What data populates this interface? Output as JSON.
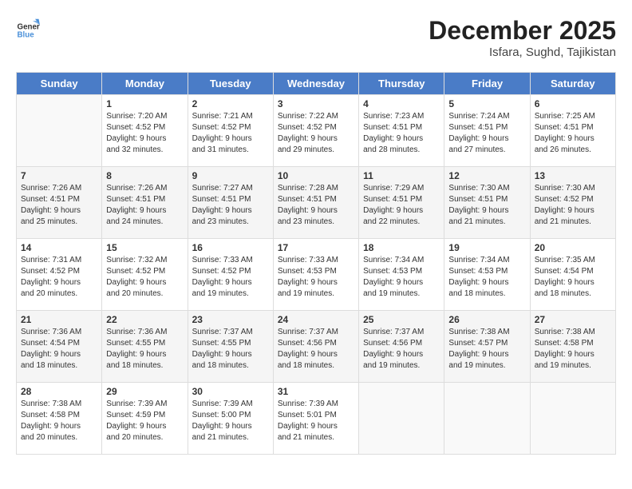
{
  "header": {
    "logo_general": "General",
    "logo_blue": "Blue",
    "month": "December 2025",
    "location": "Isfara, Sughd, Tajikistan"
  },
  "days_of_week": [
    "Sunday",
    "Monday",
    "Tuesday",
    "Wednesday",
    "Thursday",
    "Friday",
    "Saturday"
  ],
  "weeks": [
    [
      {
        "day": "",
        "info": ""
      },
      {
        "day": "1",
        "info": "Sunrise: 7:20 AM\nSunset: 4:52 PM\nDaylight: 9 hours\nand 32 minutes."
      },
      {
        "day": "2",
        "info": "Sunrise: 7:21 AM\nSunset: 4:52 PM\nDaylight: 9 hours\nand 31 minutes."
      },
      {
        "day": "3",
        "info": "Sunrise: 7:22 AM\nSunset: 4:52 PM\nDaylight: 9 hours\nand 29 minutes."
      },
      {
        "day": "4",
        "info": "Sunrise: 7:23 AM\nSunset: 4:51 PM\nDaylight: 9 hours\nand 28 minutes."
      },
      {
        "day": "5",
        "info": "Sunrise: 7:24 AM\nSunset: 4:51 PM\nDaylight: 9 hours\nand 27 minutes."
      },
      {
        "day": "6",
        "info": "Sunrise: 7:25 AM\nSunset: 4:51 PM\nDaylight: 9 hours\nand 26 minutes."
      }
    ],
    [
      {
        "day": "7",
        "info": "Sunrise: 7:26 AM\nSunset: 4:51 PM\nDaylight: 9 hours\nand 25 minutes."
      },
      {
        "day": "8",
        "info": "Sunrise: 7:26 AM\nSunset: 4:51 PM\nDaylight: 9 hours\nand 24 minutes."
      },
      {
        "day": "9",
        "info": "Sunrise: 7:27 AM\nSunset: 4:51 PM\nDaylight: 9 hours\nand 23 minutes."
      },
      {
        "day": "10",
        "info": "Sunrise: 7:28 AM\nSunset: 4:51 PM\nDaylight: 9 hours\nand 23 minutes."
      },
      {
        "day": "11",
        "info": "Sunrise: 7:29 AM\nSunset: 4:51 PM\nDaylight: 9 hours\nand 22 minutes."
      },
      {
        "day": "12",
        "info": "Sunrise: 7:30 AM\nSunset: 4:51 PM\nDaylight: 9 hours\nand 21 minutes."
      },
      {
        "day": "13",
        "info": "Sunrise: 7:30 AM\nSunset: 4:52 PM\nDaylight: 9 hours\nand 21 minutes."
      }
    ],
    [
      {
        "day": "14",
        "info": "Sunrise: 7:31 AM\nSunset: 4:52 PM\nDaylight: 9 hours\nand 20 minutes."
      },
      {
        "day": "15",
        "info": "Sunrise: 7:32 AM\nSunset: 4:52 PM\nDaylight: 9 hours\nand 20 minutes."
      },
      {
        "day": "16",
        "info": "Sunrise: 7:33 AM\nSunset: 4:52 PM\nDaylight: 9 hours\nand 19 minutes."
      },
      {
        "day": "17",
        "info": "Sunrise: 7:33 AM\nSunset: 4:53 PM\nDaylight: 9 hours\nand 19 minutes."
      },
      {
        "day": "18",
        "info": "Sunrise: 7:34 AM\nSunset: 4:53 PM\nDaylight: 9 hours\nand 19 minutes."
      },
      {
        "day": "19",
        "info": "Sunrise: 7:34 AM\nSunset: 4:53 PM\nDaylight: 9 hours\nand 18 minutes."
      },
      {
        "day": "20",
        "info": "Sunrise: 7:35 AM\nSunset: 4:54 PM\nDaylight: 9 hours\nand 18 minutes."
      }
    ],
    [
      {
        "day": "21",
        "info": "Sunrise: 7:36 AM\nSunset: 4:54 PM\nDaylight: 9 hours\nand 18 minutes."
      },
      {
        "day": "22",
        "info": "Sunrise: 7:36 AM\nSunset: 4:55 PM\nDaylight: 9 hours\nand 18 minutes."
      },
      {
        "day": "23",
        "info": "Sunrise: 7:37 AM\nSunset: 4:55 PM\nDaylight: 9 hours\nand 18 minutes."
      },
      {
        "day": "24",
        "info": "Sunrise: 7:37 AM\nSunset: 4:56 PM\nDaylight: 9 hours\nand 18 minutes."
      },
      {
        "day": "25",
        "info": "Sunrise: 7:37 AM\nSunset: 4:56 PM\nDaylight: 9 hours\nand 19 minutes."
      },
      {
        "day": "26",
        "info": "Sunrise: 7:38 AM\nSunset: 4:57 PM\nDaylight: 9 hours\nand 19 minutes."
      },
      {
        "day": "27",
        "info": "Sunrise: 7:38 AM\nSunset: 4:58 PM\nDaylight: 9 hours\nand 19 minutes."
      }
    ],
    [
      {
        "day": "28",
        "info": "Sunrise: 7:38 AM\nSunset: 4:58 PM\nDaylight: 9 hours\nand 20 minutes."
      },
      {
        "day": "29",
        "info": "Sunrise: 7:39 AM\nSunset: 4:59 PM\nDaylight: 9 hours\nand 20 minutes."
      },
      {
        "day": "30",
        "info": "Sunrise: 7:39 AM\nSunset: 5:00 PM\nDaylight: 9 hours\nand 21 minutes."
      },
      {
        "day": "31",
        "info": "Sunrise: 7:39 AM\nSunset: 5:01 PM\nDaylight: 9 hours\nand 21 minutes."
      },
      {
        "day": "",
        "info": ""
      },
      {
        "day": "",
        "info": ""
      },
      {
        "day": "",
        "info": ""
      }
    ]
  ]
}
